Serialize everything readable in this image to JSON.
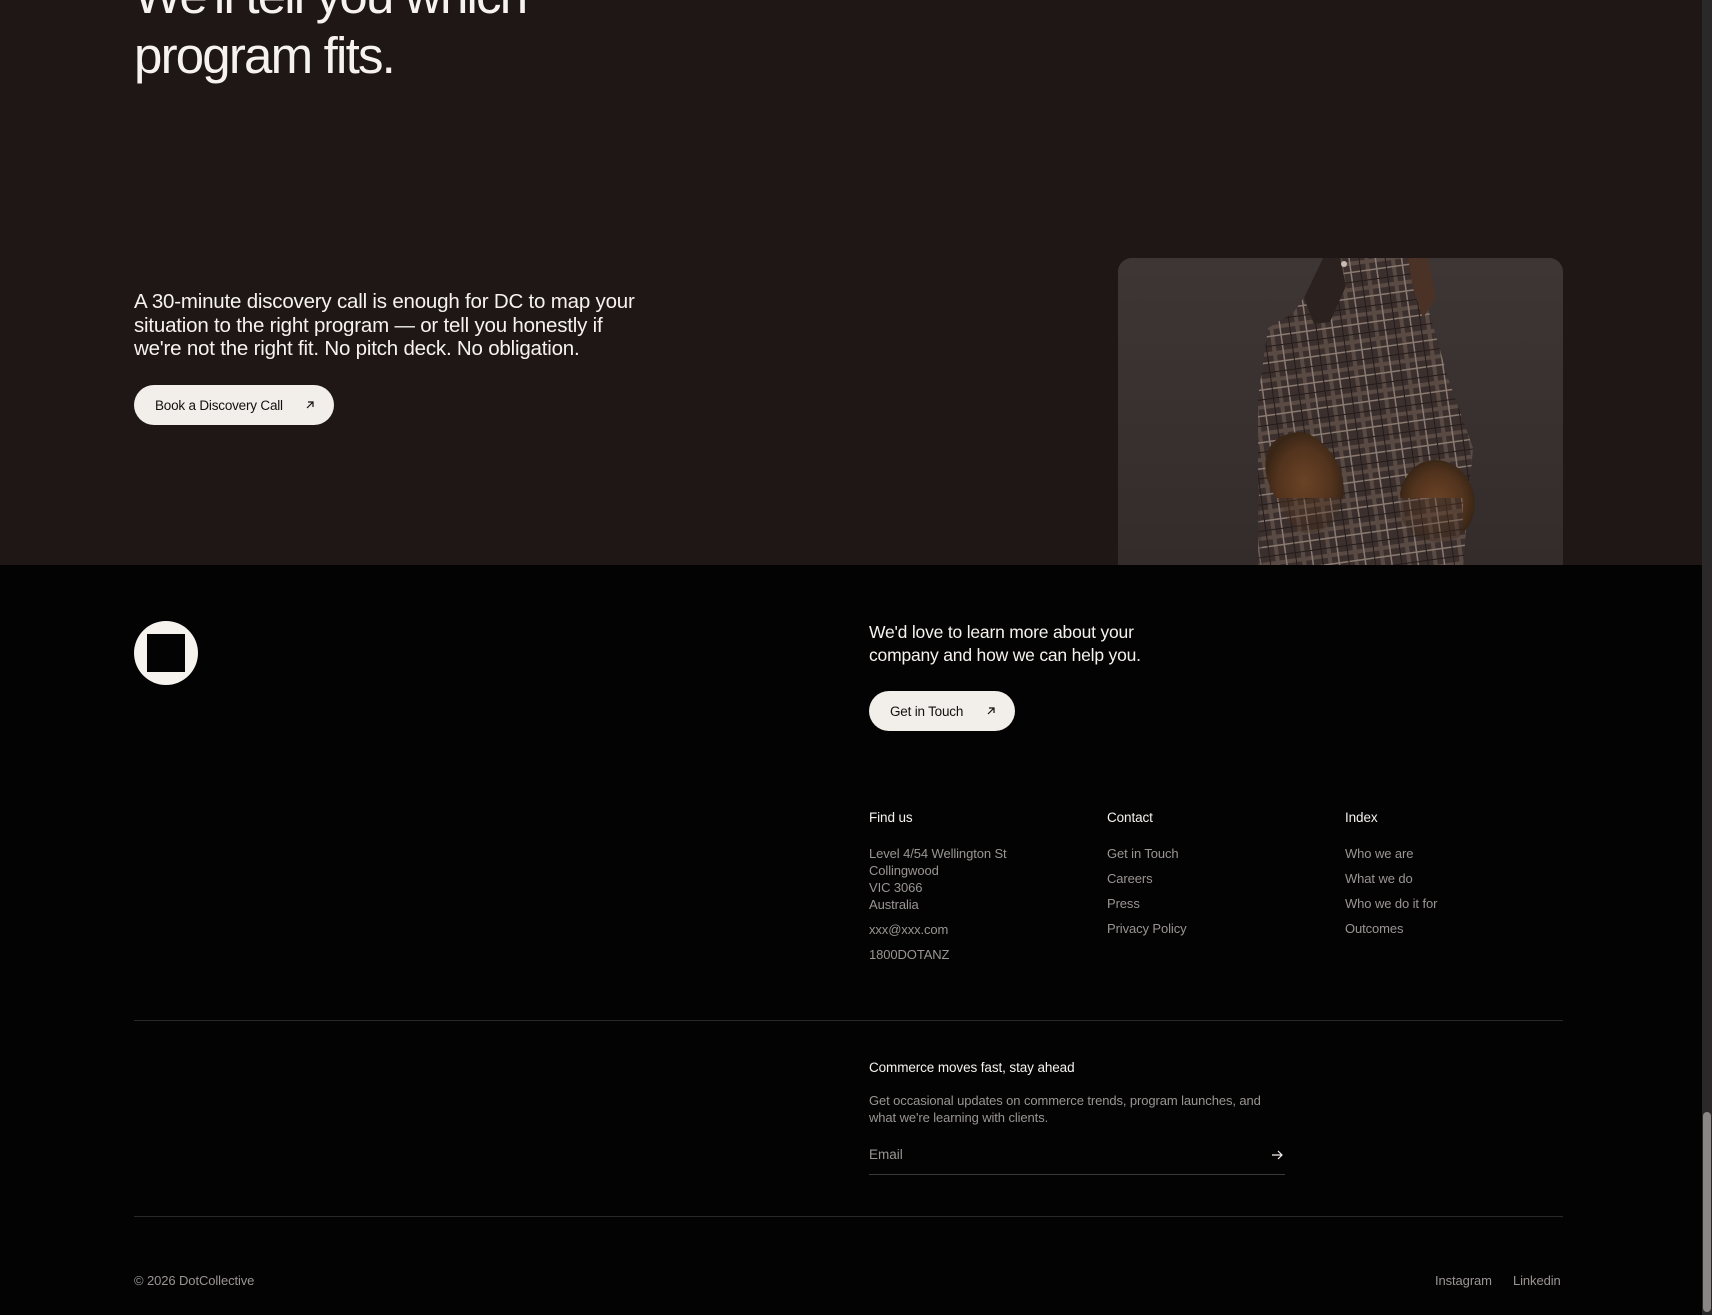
{
  "hero": {
    "title_line_1": "We'll tell you which",
    "title_line_2": "program fits.",
    "body": "A 30-minute discovery call is enough for DC to map your situation to the right program — or tell you honestly if we're not the right fit. No pitch deck. No obligation.",
    "cta_label": "Book a Discovery Call"
  },
  "footer": {
    "lead": "We'd love to learn more about your company and how we can help you.",
    "cta_label": "Get in Touch",
    "find_us": {
      "heading": "Find us",
      "address_lines": [
        "Level 4/54 Wellington St",
        "Collingwood",
        "VIC 3066",
        "Australia"
      ],
      "email": "xxx@xxx.com",
      "phone": "1800DOTANZ"
    },
    "contact": {
      "heading": "Contact",
      "items": [
        "Get in Touch",
        "Careers",
        "Press",
        "Privacy Policy"
      ]
    },
    "index": {
      "heading": "Index",
      "items": [
        "Who we are",
        "What we do",
        "Who we do it for",
        "Outcomes"
      ]
    },
    "newsletter": {
      "title": "Commerce moves fast, stay ahead",
      "description": "Get occasional updates on commerce trends, program launches, and what we're learning with clients.",
      "email_placeholder": "Email"
    },
    "copyright": "© 2026 DotCollective",
    "social": [
      "Instagram",
      "Linkedin"
    ]
  },
  "colors": {
    "hero_bg": "#1f1716",
    "footer_bg": "#030303",
    "pill_bg": "#f2eeea",
    "muted_text": "#9a9593"
  },
  "icons": {
    "cta_arrow": "arrow-up-right-icon",
    "submit_arrow": "arrow-right-icon",
    "logo": "dot-collective-logo"
  }
}
